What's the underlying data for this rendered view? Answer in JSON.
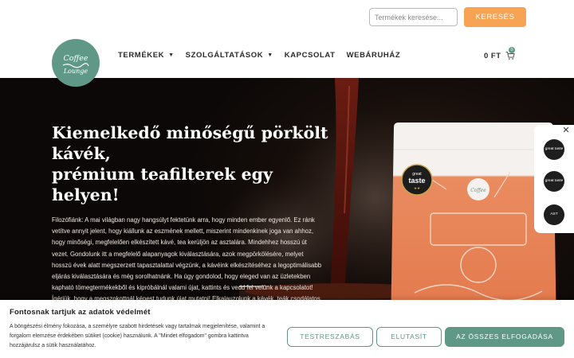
{
  "colors": {
    "accent": "#5f9887",
    "search_button": "#f6a354",
    "hero_bg": "#0b0807",
    "bag_orange": "#e98a5e"
  },
  "search": {
    "placeholder": "Termékek keresése...",
    "button_label": "KERESÉS"
  },
  "logo": {
    "text": "Coffee Lounge",
    "icon": "coffee-logo-icon"
  },
  "nav": {
    "items": [
      {
        "label": "TERMÉKEK",
        "has_dropdown": true
      },
      {
        "label": "SZOLGÁLTATÁSOK",
        "has_dropdown": true
      },
      {
        "label": "KAPCSOLAT",
        "has_dropdown": false
      },
      {
        "label": "WEBÁRUHÁZ",
        "has_dropdown": false
      }
    ]
  },
  "cart": {
    "total": "0 FT",
    "count": "0",
    "icon": "cart-icon"
  },
  "hero": {
    "title_lines": [
      "Kiemelkedő minőségű pörkölt",
      "kávék,",
      "prémium teafilterek egy helyen!"
    ],
    "description": "Filozófiánk: A mai világban nagy hangsúlyt fektetünk arra, hogy minden ember egyenlő. Ez ránk vetítve annyit jelent, hogy kiállunk az eszmének mellett, miszerint mindenkinek joga van ahhoz, hogy minőségi, megfelelően elkészített kávé, tea kerüljön az asztalára. Mindehhez hosszú út vezet. Gondolunk itt a megfelelő alapanyagok kiválasztására, azok megpörkölésére, melyet hosszú évek alatt megszerzett tapasztalattal végzünk, a kávéink elkészítéséhez a legoptimálisabb eljárás kiválasztására és még sorolhatnánk. Ha úgy gondolod, hogy eleged van az üzletekben kapható tömegtermékekből és kipróbálnál valami újat, kattints és vedd fel velünk a kapcsolatot! Ígérjük, hogy a megszokottnál képest tudunk újat mutatni! Elkalauzolunk a kávék, teák csodálatos világába!",
    "bag_badge": "great taste"
  },
  "awards": {
    "close_icon": "close-icon",
    "items": [
      {
        "text": "great taste"
      },
      {
        "text": "great taste"
      },
      {
        "text": "AST"
      }
    ]
  },
  "cookie": {
    "title": "Fontosnak tartjuk az adatok védelmét",
    "text": "A böngészési élmény fokozása, a személyre szabott hirdetések vagy tartalmak megjelenítése, valamint a forgalom elemzése érdekében sütiket (cookie) használunk. A \"Mindet elfogadom\" gombra kattintva hozzájárulsz a sütik használatához.",
    "buttons": {
      "settings": "TESTRESZABÁS",
      "decline": "ELUTASÍT",
      "accept": "AZ ÖSSZES ELFOGADÁSA"
    }
  }
}
